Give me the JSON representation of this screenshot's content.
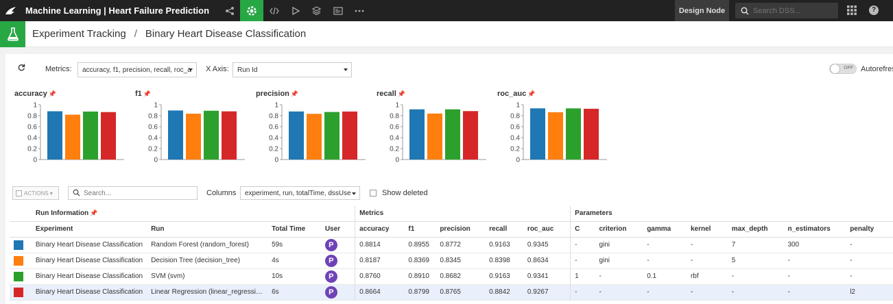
{
  "topbar": {
    "project_title": "Machine Learning | Heart Failure Prediction",
    "design_node": "Design Node",
    "search_placeholder": "Search DSS...",
    "help": "?"
  },
  "breadcrumb": {
    "section": "Experiment Tracking",
    "separator": "/",
    "experiment": "Binary Heart Disease Classification"
  },
  "controls": {
    "metrics_label": "Metrics:",
    "metrics_value": "accuracy, f1, precision, recall, roc_a",
    "xaxis_label": "X Axis:",
    "xaxis_value": "Run Id",
    "toggle_state": "OFF",
    "autorefresh_label": "Autorefresh"
  },
  "colors": {
    "rf": "#1f77b4",
    "dt": "#ff7f0e",
    "svm": "#2ca02c",
    "lr": "#d62728",
    "accent": "#28a745"
  },
  "chart_data": [
    {
      "type": "bar",
      "title": "accuracy",
      "ylim": [
        0,
        1
      ],
      "yticks": [
        "0",
        "0.2",
        "0.4",
        "0.6",
        "0.8",
        "1"
      ],
      "series_colors": [
        "#1f77b4",
        "#ff7f0e",
        "#2ca02c",
        "#d62728"
      ],
      "values": [
        0.8814,
        0.8187,
        0.876,
        0.8664
      ]
    },
    {
      "type": "bar",
      "title": "f1",
      "ylim": [
        0,
        1
      ],
      "yticks": [
        "0",
        "0.2",
        "0.4",
        "0.6",
        "0.8",
        "1"
      ],
      "series_colors": [
        "#1f77b4",
        "#ff7f0e",
        "#2ca02c",
        "#d62728"
      ],
      "values": [
        0.8955,
        0.8369,
        0.891,
        0.8799
      ]
    },
    {
      "type": "bar",
      "title": "precision",
      "ylim": [
        0,
        1
      ],
      "yticks": [
        "0",
        "0.2",
        "0.4",
        "0.6",
        "0.8",
        "1"
      ],
      "series_colors": [
        "#1f77b4",
        "#ff7f0e",
        "#2ca02c",
        "#d62728"
      ],
      "values": [
        0.8772,
        0.8345,
        0.8682,
        0.8765
      ]
    },
    {
      "type": "bar",
      "title": "recall",
      "ylim": [
        0,
        1
      ],
      "yticks": [
        "0",
        "0.2",
        "0.4",
        "0.6",
        "0.8",
        "1"
      ],
      "series_colors": [
        "#1f77b4",
        "#ff7f0e",
        "#2ca02c",
        "#d62728"
      ],
      "values": [
        0.9163,
        0.8398,
        0.9163,
        0.8842
      ]
    },
    {
      "type": "bar",
      "title": "roc_auc",
      "ylim": [
        0,
        1
      ],
      "yticks": [
        "0",
        "0.2",
        "0.4",
        "0.6",
        "0.8",
        "1"
      ],
      "series_colors": [
        "#1f77b4",
        "#ff7f0e",
        "#2ca02c",
        "#d62728"
      ],
      "values": [
        0.9345,
        0.8634,
        0.9341,
        0.9267
      ]
    }
  ],
  "table_tools": {
    "actions_label": "ACTIONS",
    "search_placeholder": "Search...",
    "columns_label": "Columns",
    "columns_value": "experiment, run, totalTime, dssUse",
    "show_deleted_label": "Show deleted"
  },
  "table": {
    "groups": {
      "run_info": "Run Information",
      "metrics": "Metrics",
      "parameters": "Parameters"
    },
    "headers": [
      "Experiment",
      "Run",
      "Total Time",
      "User",
      "accuracy",
      "f1",
      "precision",
      "recall",
      "roc_auc",
      "C",
      "criterion",
      "gamma",
      "kernel",
      "max_depth",
      "n_estimators",
      "penalty"
    ],
    "rows": [
      {
        "color": "#1f77b4",
        "cells": [
          "Binary Heart Disease Classification",
          "Random Forest (random_forest)",
          "59s",
          "P",
          "0.8814",
          "0.8955",
          "0.8772",
          "0.9163",
          "0.9345",
          "-",
          "gini",
          "-",
          "-",
          "7",
          "300",
          "-"
        ]
      },
      {
        "color": "#ff7f0e",
        "cells": [
          "Binary Heart Disease Classification",
          "Decision Tree (decision_tree)",
          "4s",
          "P",
          "0.8187",
          "0.8369",
          "0.8345",
          "0.8398",
          "0.8634",
          "-",
          "gini",
          "-",
          "-",
          "5",
          "-",
          "-"
        ]
      },
      {
        "color": "#2ca02c",
        "cells": [
          "Binary Heart Disease Classification",
          "SVM (svm)",
          "10s",
          "P",
          "0.8760",
          "0.8910",
          "0.8682",
          "0.9163",
          "0.9341",
          "1",
          "-",
          "0.1",
          "rbf",
          "-",
          "-",
          "-"
        ]
      },
      {
        "color": "#d62728",
        "cells": [
          "Binary Heart Disease Classification",
          "Linear Regression (linear_regressi…",
          "6s",
          "P",
          "0.8664",
          "0.8799",
          "0.8765",
          "0.8842",
          "0.9267",
          "-",
          "-",
          "-",
          "-",
          "-",
          "-",
          "l2"
        ]
      }
    ]
  }
}
